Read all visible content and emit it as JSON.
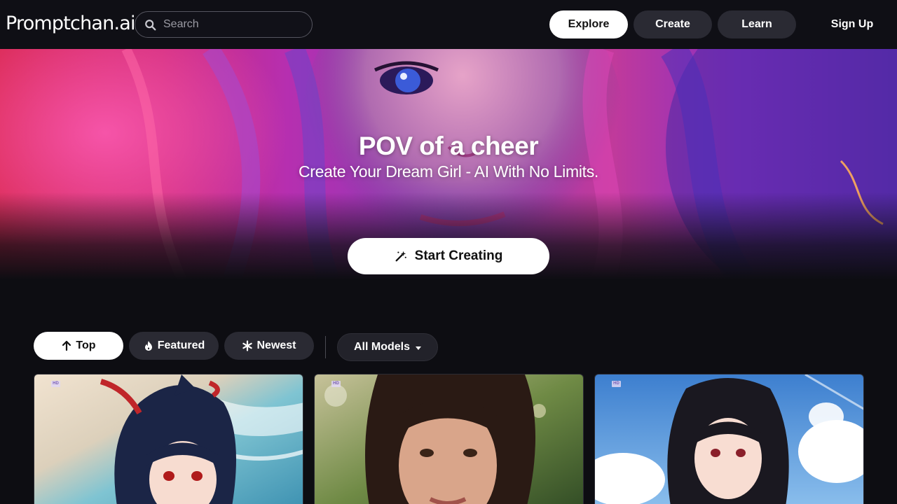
{
  "header": {
    "logo": "Promptchan.ai",
    "search": {
      "placeholder": "Search",
      "value": "",
      "icon": "search-icon"
    },
    "nav": [
      {
        "label": "Explore",
        "active": true
      },
      {
        "label": "Create",
        "active": false
      },
      {
        "label": "Learn",
        "active": false
      }
    ],
    "signup_label": "Sign Up"
  },
  "hero": {
    "title": "POV of a cheer",
    "subtitle": "Create Your Dream Girl - AI With No Limits.",
    "cta_label": "Start Creating",
    "cta_icon": "magic-wand-icon"
  },
  "filters": {
    "tabs": [
      {
        "label": "Top",
        "icon": "arrow-up-icon",
        "active": true
      },
      {
        "label": "Featured",
        "icon": "flame-icon",
        "active": false
      },
      {
        "label": "Newest",
        "icon": "asterisk-icon",
        "active": false
      }
    ],
    "models_label": "All Models"
  },
  "gallery": {
    "cards": [
      {
        "badge": "HD",
        "subject": "anime girl on beach"
      },
      {
        "badge": "HD",
        "subject": "photo portrait woman"
      },
      {
        "badge": "HD",
        "subject": "anime girl with sky"
      }
    ]
  },
  "colors": {
    "background": "#0d0d12",
    "header": "#0f0f15",
    "pill_dark": "#2a2a33",
    "pill_light": "#ffffff",
    "hero_pink": "#e0208c",
    "hero_purple": "#7a2fd6"
  }
}
